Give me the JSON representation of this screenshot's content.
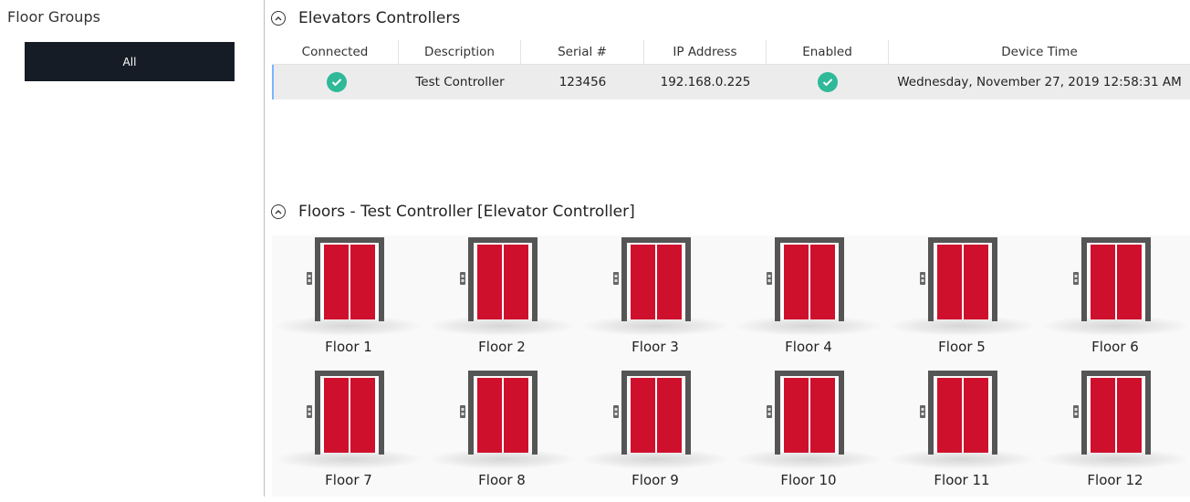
{
  "sidebar": {
    "title": "Floor Groups",
    "groups": [
      {
        "label": "All"
      }
    ]
  },
  "controllers": {
    "title": "Elevators Controllers",
    "columns": [
      "Connected",
      "Description",
      "Serial #",
      "IP Address",
      "Enabled",
      "Device Time"
    ],
    "rows": [
      {
        "connected": true,
        "description": "Test Controller",
        "serial": "123456",
        "ip": "192.168.0.225",
        "enabled": true,
        "device_time": "Wednesday, November 27, 2019 12:58:31 AM"
      }
    ]
  },
  "floors": {
    "title": "Floors - Test Controller [Elevator Controller]",
    "items": [
      {
        "label": "Floor 1"
      },
      {
        "label": "Floor 2"
      },
      {
        "label": "Floor 3"
      },
      {
        "label": "Floor 4"
      },
      {
        "label": "Floor 5"
      },
      {
        "label": "Floor 6"
      },
      {
        "label": "Floor 7"
      },
      {
        "label": "Floor 8"
      },
      {
        "label": "Floor 9"
      },
      {
        "label": "Floor 10"
      },
      {
        "label": "Floor 11"
      },
      {
        "label": "Floor 12"
      }
    ]
  },
  "colors": {
    "sidebar_button": "#151c26",
    "check_green": "#2fb998",
    "elevator_door": "#cf102d",
    "elevator_frame": "#555555",
    "row_background": "#ececec"
  },
  "icons": {
    "collapse": "chevron-up-circle-icon",
    "status": "check-circle-icon",
    "floor": "elevator-icon"
  }
}
